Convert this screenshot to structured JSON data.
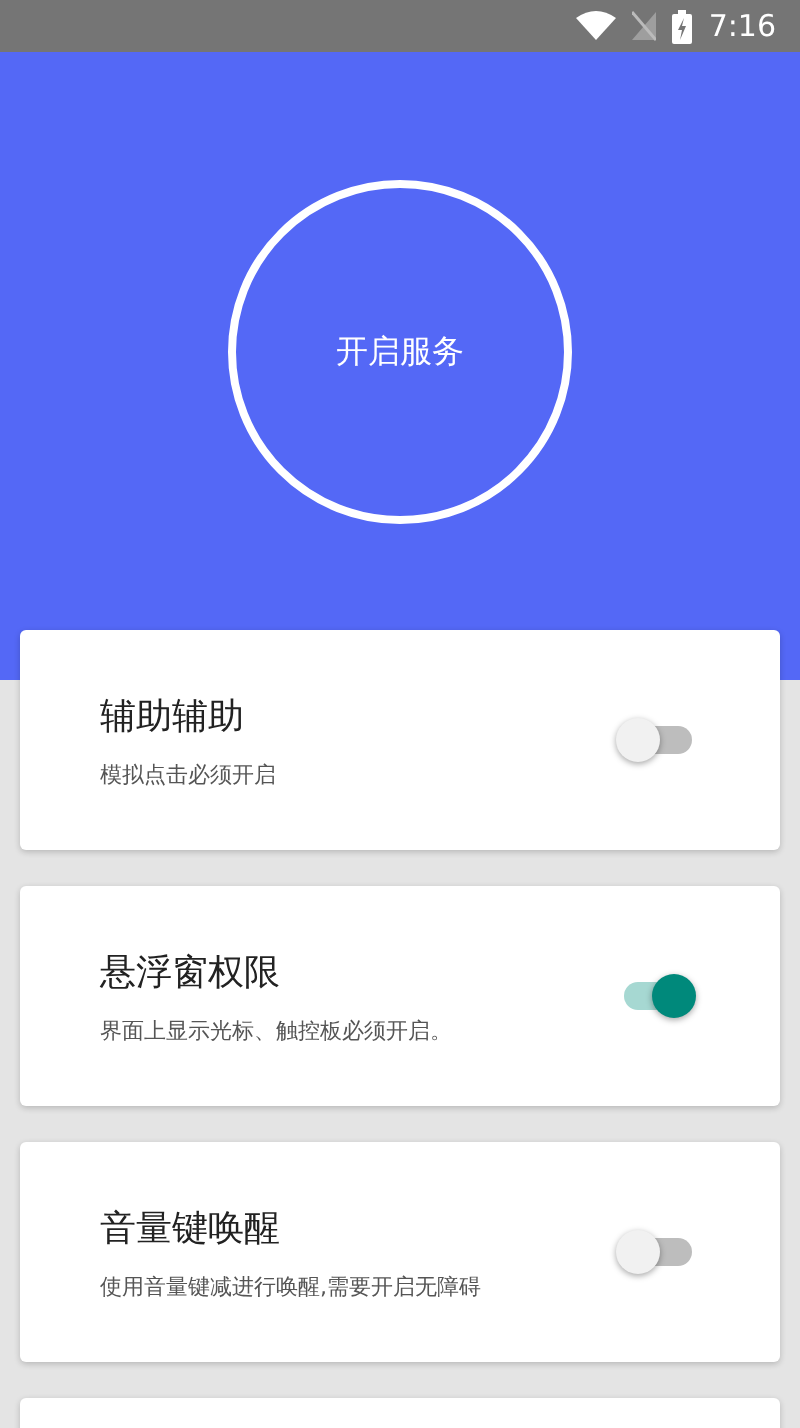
{
  "status_bar": {
    "time": "7:16"
  },
  "service_button": {
    "label": "开启服务"
  },
  "settings": [
    {
      "title": "辅助辅助",
      "description": "模拟点击必须开启",
      "on": false
    },
    {
      "title": "悬浮窗权限",
      "description": "界面上显示光标、触控板必须开启。",
      "on": true
    },
    {
      "title": "音量键唤醒",
      "description": "使用音量键减进行唤醒,需要开启无障碍",
      "on": false
    }
  ]
}
